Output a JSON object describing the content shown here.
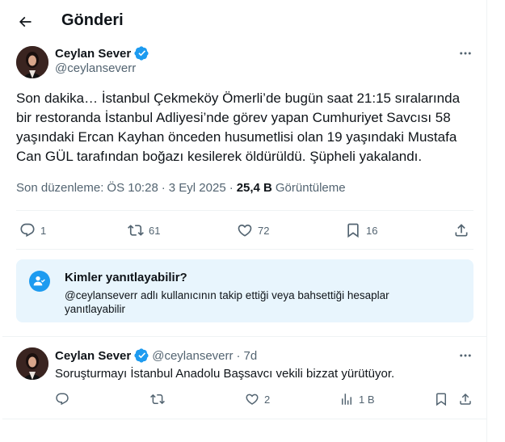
{
  "header": {
    "title": "Gönderi"
  },
  "post": {
    "author_name": "Ceylan Sever",
    "author_handle": "@ceylanseverr",
    "text": "Son dakika… İstanbul Çekmeköy Ömerli’de bugün saat 21:15 sıralarında bir restoranda İstanbul Adliyesi’nde görev yapan Cumhuriyet Savcısı 58 yaşındaki Ercan Kayhan önceden husumetlisi olan 19 yaşındaki Mustafa Can GÜL tarafından boğazı kesilerek öldürüldü. Şüpheli yakalandı.",
    "edited_label": "Son düzenleme:",
    "time": "ÖS 10:28",
    "sep": "·",
    "date": "3 Eyl 2025",
    "views_count": "25,4 B",
    "views_label": "Görüntüleme",
    "stats": {
      "replies": "1",
      "reposts": "61",
      "likes": "72",
      "bookmarks": "16"
    }
  },
  "reply_restriction": {
    "title": "Kimler yanıtlayabilir?",
    "description": "@ceylanseverr adlı kullanıcının takip ettiği veya bahsettiği hesaplar yanıtlayabilir"
  },
  "comment": {
    "author_name": "Ceylan Sever",
    "author_handle": "@ceylanseverr",
    "sep": "·",
    "age": "7d",
    "text": "Soruşturmayı İstanbul Anadolu Başsavcı vekili bizzat yürütüyor.",
    "stats": {
      "replies": "",
      "reposts": "",
      "likes": "2",
      "views": "1 B"
    }
  },
  "colors": {
    "accent": "#1d9bf0",
    "text": "#0f1419",
    "muted": "#536471",
    "reply_box_bg": "#e8f5fd"
  },
  "icons": [
    "back-arrow-icon",
    "verified-badge-icon",
    "more-icon",
    "reply-icon",
    "repost-icon",
    "like-icon",
    "bookmark-icon",
    "share-icon",
    "person-check-icon",
    "views-icon"
  ]
}
